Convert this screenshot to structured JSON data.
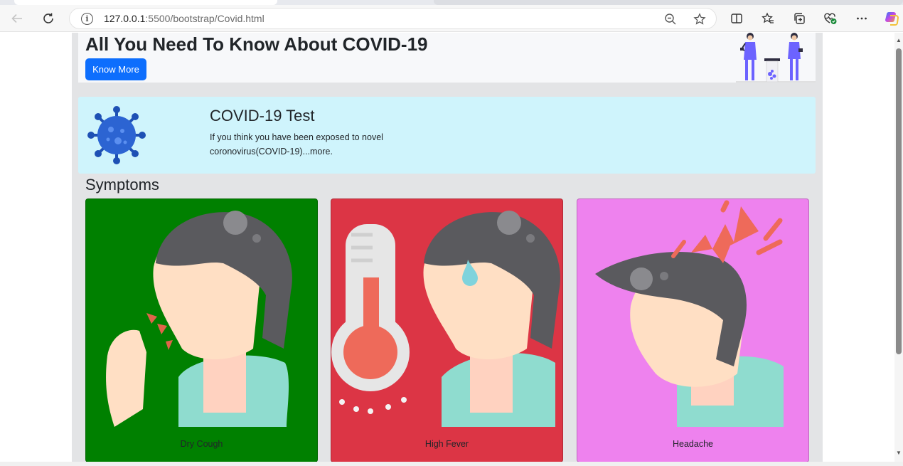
{
  "browser": {
    "url_host": "127.0.0.1",
    "url_rest": ":5500/bootstrap/Covid.html"
  },
  "hero": {
    "title": "All You Need To Know About COVID-19",
    "button_label": "Know More"
  },
  "test_card": {
    "title": "COVID-19 Test",
    "text": "If you think you have been exposed to novel coronovirus(COVID-19)...more."
  },
  "symptoms": {
    "heading": "Symptoms",
    "cards": [
      {
        "label": "Dry Cough",
        "bg": "#008000"
      },
      {
        "label": "High Fever",
        "bg": "#dc3545"
      },
      {
        "label": "Headache",
        "bg": "#ee82ee"
      }
    ]
  },
  "colors": {
    "primary": "#0d6efd",
    "info_bg": "#cff4fc",
    "page_bg": "#e3e4e6"
  },
  "icons": [
    "back-arrow-icon",
    "reload-icon",
    "info-icon",
    "zoom-out-icon",
    "star-icon",
    "split-screen-icon",
    "favorites-icon",
    "collections-icon",
    "health-icon",
    "more-icon",
    "copilot-icon"
  ]
}
